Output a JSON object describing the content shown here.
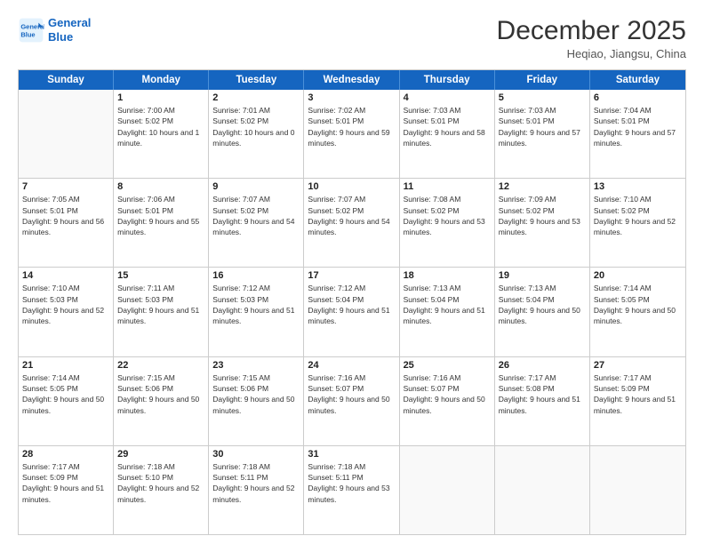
{
  "header": {
    "logo_line1": "General",
    "logo_line2": "Blue",
    "title": "December 2025",
    "subtitle": "Heqiao, Jiangsu, China"
  },
  "days_of_week": [
    "Sunday",
    "Monday",
    "Tuesday",
    "Wednesday",
    "Thursday",
    "Friday",
    "Saturday"
  ],
  "weeks": [
    [
      {
        "day": "",
        "empty": true
      },
      {
        "day": "1",
        "rise": "7:00 AM",
        "set": "5:02 PM",
        "daylight": "10 hours and 1 minute."
      },
      {
        "day": "2",
        "rise": "7:01 AM",
        "set": "5:02 PM",
        "daylight": "10 hours and 0 minutes."
      },
      {
        "day": "3",
        "rise": "7:02 AM",
        "set": "5:01 PM",
        "daylight": "9 hours and 59 minutes."
      },
      {
        "day": "4",
        "rise": "7:03 AM",
        "set": "5:01 PM",
        "daylight": "9 hours and 58 minutes."
      },
      {
        "day": "5",
        "rise": "7:03 AM",
        "set": "5:01 PM",
        "daylight": "9 hours and 57 minutes."
      },
      {
        "day": "6",
        "rise": "7:04 AM",
        "set": "5:01 PM",
        "daylight": "9 hours and 57 minutes."
      }
    ],
    [
      {
        "day": "7",
        "rise": "7:05 AM",
        "set": "5:01 PM",
        "daylight": "9 hours and 56 minutes."
      },
      {
        "day": "8",
        "rise": "7:06 AM",
        "set": "5:01 PM",
        "daylight": "9 hours and 55 minutes."
      },
      {
        "day": "9",
        "rise": "7:07 AM",
        "set": "5:02 PM",
        "daylight": "9 hours and 54 minutes."
      },
      {
        "day": "10",
        "rise": "7:07 AM",
        "set": "5:02 PM",
        "daylight": "9 hours and 54 minutes."
      },
      {
        "day": "11",
        "rise": "7:08 AM",
        "set": "5:02 PM",
        "daylight": "9 hours and 53 minutes."
      },
      {
        "day": "12",
        "rise": "7:09 AM",
        "set": "5:02 PM",
        "daylight": "9 hours and 53 minutes."
      },
      {
        "day": "13",
        "rise": "7:10 AM",
        "set": "5:02 PM",
        "daylight": "9 hours and 52 minutes."
      }
    ],
    [
      {
        "day": "14",
        "rise": "7:10 AM",
        "set": "5:03 PM",
        "daylight": "9 hours and 52 minutes."
      },
      {
        "day": "15",
        "rise": "7:11 AM",
        "set": "5:03 PM",
        "daylight": "9 hours and 51 minutes."
      },
      {
        "day": "16",
        "rise": "7:12 AM",
        "set": "5:03 PM",
        "daylight": "9 hours and 51 minutes."
      },
      {
        "day": "17",
        "rise": "7:12 AM",
        "set": "5:04 PM",
        "daylight": "9 hours and 51 minutes."
      },
      {
        "day": "18",
        "rise": "7:13 AM",
        "set": "5:04 PM",
        "daylight": "9 hours and 51 minutes."
      },
      {
        "day": "19",
        "rise": "7:13 AM",
        "set": "5:04 PM",
        "daylight": "9 hours and 50 minutes."
      },
      {
        "day": "20",
        "rise": "7:14 AM",
        "set": "5:05 PM",
        "daylight": "9 hours and 50 minutes."
      }
    ],
    [
      {
        "day": "21",
        "rise": "7:14 AM",
        "set": "5:05 PM",
        "daylight": "9 hours and 50 minutes."
      },
      {
        "day": "22",
        "rise": "7:15 AM",
        "set": "5:06 PM",
        "daylight": "9 hours and 50 minutes."
      },
      {
        "day": "23",
        "rise": "7:15 AM",
        "set": "5:06 PM",
        "daylight": "9 hours and 50 minutes."
      },
      {
        "day": "24",
        "rise": "7:16 AM",
        "set": "5:07 PM",
        "daylight": "9 hours and 50 minutes."
      },
      {
        "day": "25",
        "rise": "7:16 AM",
        "set": "5:07 PM",
        "daylight": "9 hours and 50 minutes."
      },
      {
        "day": "26",
        "rise": "7:17 AM",
        "set": "5:08 PM",
        "daylight": "9 hours and 51 minutes."
      },
      {
        "day": "27",
        "rise": "7:17 AM",
        "set": "5:09 PM",
        "daylight": "9 hours and 51 minutes."
      }
    ],
    [
      {
        "day": "28",
        "rise": "7:17 AM",
        "set": "5:09 PM",
        "daylight": "9 hours and 51 minutes."
      },
      {
        "day": "29",
        "rise": "7:18 AM",
        "set": "5:10 PM",
        "daylight": "9 hours and 52 minutes."
      },
      {
        "day": "30",
        "rise": "7:18 AM",
        "set": "5:11 PM",
        "daylight": "9 hours and 52 minutes."
      },
      {
        "day": "31",
        "rise": "7:18 AM",
        "set": "5:11 PM",
        "daylight": "9 hours and 53 minutes."
      },
      {
        "day": "",
        "empty": true
      },
      {
        "day": "",
        "empty": true
      },
      {
        "day": "",
        "empty": true
      }
    ]
  ],
  "labels": {
    "sunrise": "Sunrise:",
    "sunset": "Sunset:",
    "daylight": "Daylight:"
  },
  "colors": {
    "header_bg": "#1565c0"
  }
}
